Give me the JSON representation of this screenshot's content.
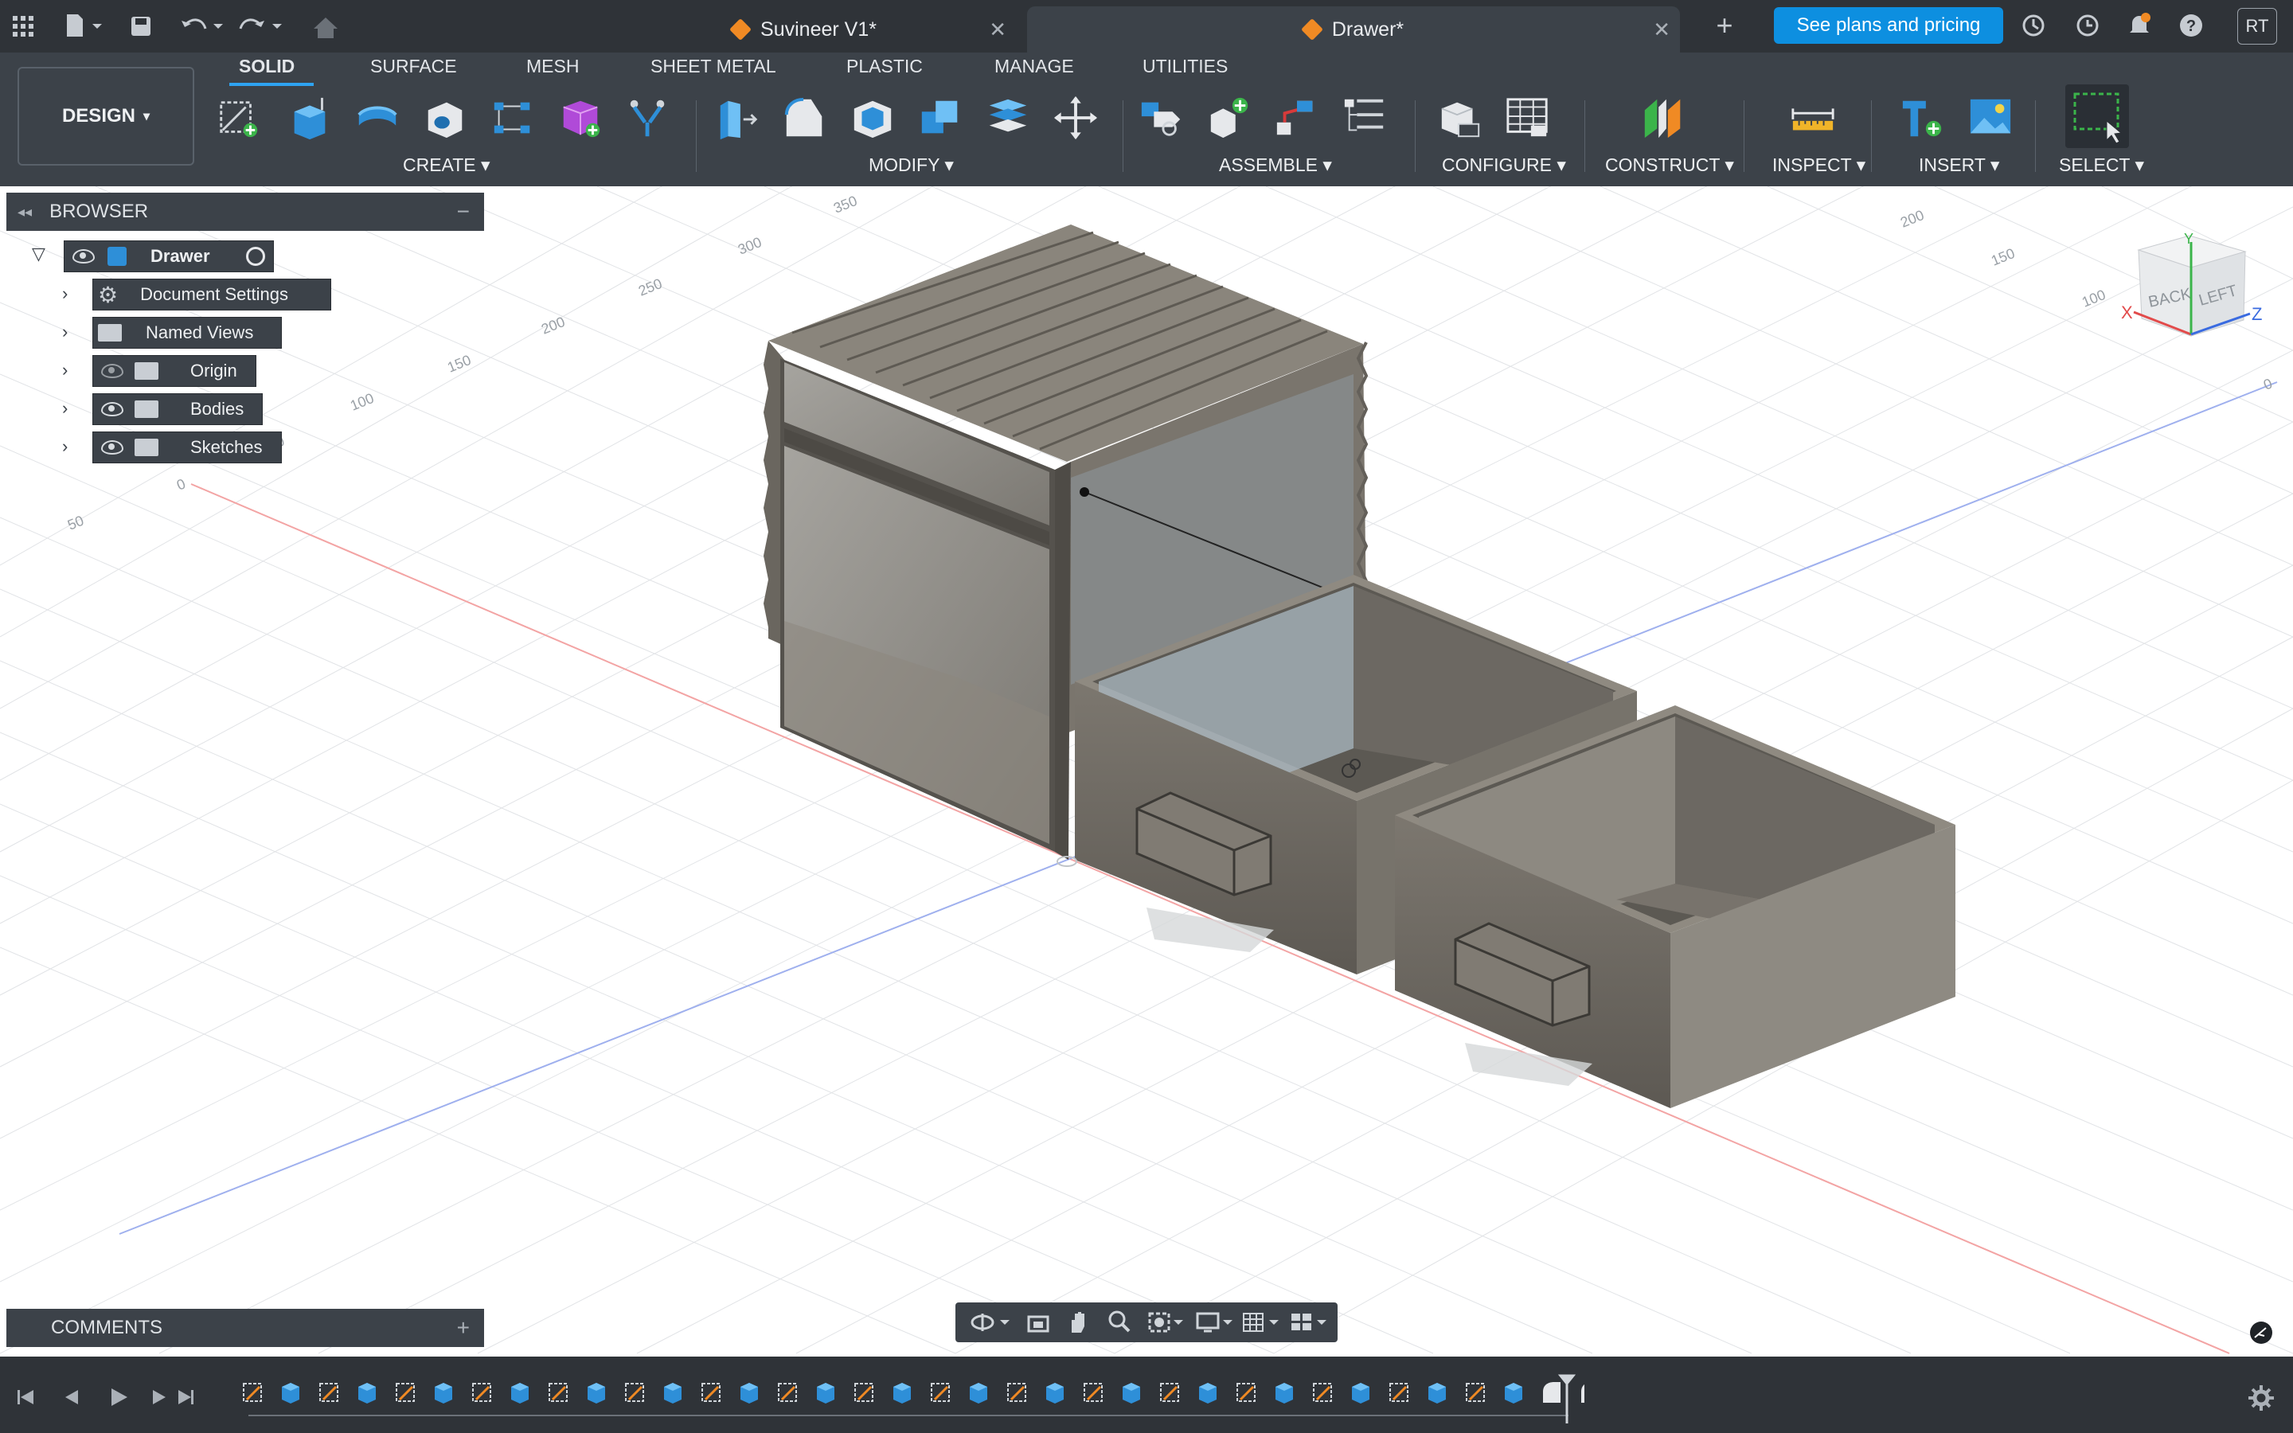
{
  "titlebar": {
    "tabs": [
      {
        "label": "Suvineer V1*",
        "active": false
      },
      {
        "label": "Drawer*",
        "active": true
      }
    ],
    "plans_button": "See plans and pricing",
    "avatar_initials": "RT",
    "icons": [
      "grid-icon",
      "file-icon",
      "save-icon",
      "undo-icon",
      "redo-icon",
      "home-icon",
      "new-tab-icon",
      "refresh-icon",
      "clock-icon",
      "bell-icon",
      "help-icon"
    ]
  },
  "toolbar": {
    "workspace": "DESIGN",
    "tabs": [
      "SOLID",
      "SURFACE",
      "MESH",
      "SHEET METAL",
      "PLASTIC",
      "MANAGE",
      "UTILITIES"
    ],
    "active_tab": "SOLID",
    "groups": [
      "CREATE",
      "MODIFY",
      "ASSEMBLE",
      "CONFIGURE",
      "CONSTRUCT",
      "INSPECT",
      "INSERT",
      "SELECT"
    ]
  },
  "browser": {
    "title": "BROWSER",
    "root": "Drawer",
    "items": [
      {
        "label": "Document Settings",
        "icon": "gear-icon",
        "visible_toggle": false
      },
      {
        "label": "Named Views",
        "icon": "folder-icon",
        "visible_toggle": false
      },
      {
        "label": "Origin",
        "icon": "folder-icon",
        "visible_toggle": true,
        "hidden": true
      },
      {
        "label": "Bodies",
        "icon": "folder-icon",
        "visible_toggle": true
      },
      {
        "label": "Sketches",
        "icon": "folder-icon",
        "visible_toggle": true
      }
    ]
  },
  "comments": {
    "title": "COMMENTS"
  },
  "viewcube": {
    "faces": [
      "BACK",
      "LEFT"
    ],
    "axes": [
      "X",
      "Y",
      "Z"
    ]
  },
  "grid_labels": {
    "left": [
      "350",
      "300",
      "250",
      "200",
      "150",
      "100",
      "50",
      "0",
      "50"
    ],
    "right": [
      "200",
      "150",
      "100",
      "0"
    ]
  },
  "colors": {
    "accent": "#2ea3f2",
    "plans_button": "#0d8fe0",
    "toolbar_bg": "#3c4249",
    "titlebar_bg": "#2f3338",
    "model_grey": "#7f7a72"
  }
}
